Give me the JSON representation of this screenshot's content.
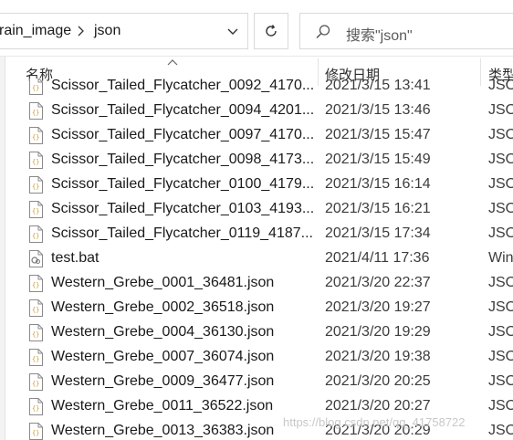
{
  "address": {
    "crumbs": [
      "rain_image",
      "json"
    ]
  },
  "search": {
    "placeholder": "搜索\"json\""
  },
  "columns": {
    "name": "名称",
    "date": "修改日期",
    "type": "类型"
  },
  "files": [
    {
      "name": "Scissor_Tailed_Flycatcher_0092_4170...",
      "date": "2021/3/15 13:41",
      "type": "JSO",
      "icon": "json-file-icon"
    },
    {
      "name": "Scissor_Tailed_Flycatcher_0094_4201...",
      "date": "2021/3/15 13:46",
      "type": "JSO",
      "icon": "json-file-icon"
    },
    {
      "name": "Scissor_Tailed_Flycatcher_0097_4170...",
      "date": "2021/3/15 15:47",
      "type": "JSO",
      "icon": "json-file-icon"
    },
    {
      "name": "Scissor_Tailed_Flycatcher_0098_4173...",
      "date": "2021/3/15 15:49",
      "type": "JSO",
      "icon": "json-file-icon"
    },
    {
      "name": "Scissor_Tailed_Flycatcher_0100_4179...",
      "date": "2021/3/15 16:14",
      "type": "JSO",
      "icon": "json-file-icon"
    },
    {
      "name": "Scissor_Tailed_Flycatcher_0103_4193...",
      "date": "2021/3/15 16:21",
      "type": "JSO",
      "icon": "json-file-icon"
    },
    {
      "name": "Scissor_Tailed_Flycatcher_0119_4187...",
      "date": "2021/3/15 17:34",
      "type": "JSO",
      "icon": "json-file-icon"
    },
    {
      "name": "test.bat",
      "date": "2021/4/11 17:36",
      "type": "Win",
      "icon": "batch-file-icon"
    },
    {
      "name": "Western_Grebe_0001_36481.json",
      "date": "2021/3/20 22:37",
      "type": "JSO",
      "icon": "json-file-icon"
    },
    {
      "name": "Western_Grebe_0002_36518.json",
      "date": "2021/3/20 19:27",
      "type": "JSO",
      "icon": "json-file-icon"
    },
    {
      "name": "Western_Grebe_0004_36130.json",
      "date": "2021/3/20 19:29",
      "type": "JSO",
      "icon": "json-file-icon"
    },
    {
      "name": "Western_Grebe_0007_36074.json",
      "date": "2021/3/20 19:38",
      "type": "JSO",
      "icon": "json-file-icon"
    },
    {
      "name": "Western_Grebe_0009_36477.json",
      "date": "2021/3/20 20:25",
      "type": "JSO",
      "icon": "json-file-icon"
    },
    {
      "name": "Western_Grebe_0011_36522.json",
      "date": "2021/3/20 20:27",
      "type": "JSO",
      "icon": "json-file-icon"
    },
    {
      "name": "Western_Grebe_0013_36383.json",
      "date": "2021/3/20 20:29",
      "type": "JSO",
      "icon": "json-file-icon"
    }
  ],
  "watermark": "https://blog.csdn.net/qq_41758722"
}
